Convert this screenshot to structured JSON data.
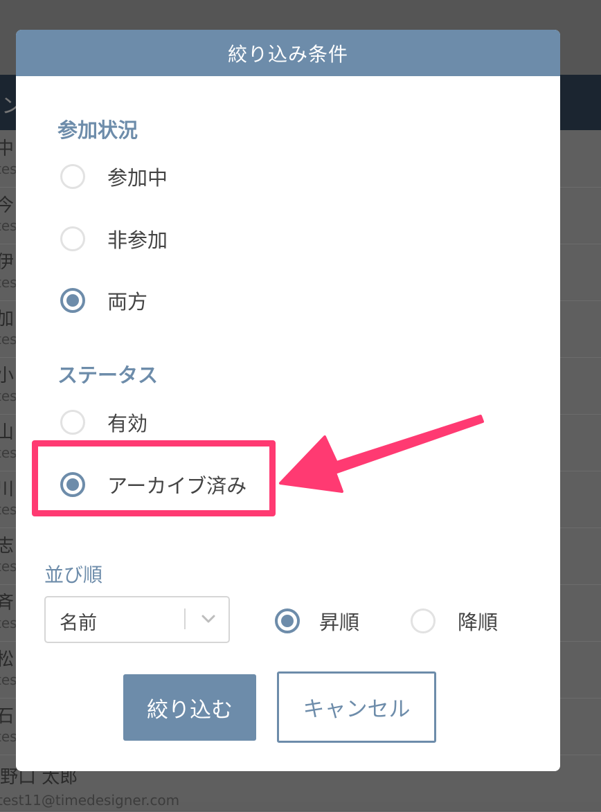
{
  "background": {
    "header_text": "ン",
    "rows": [
      {
        "name": "中",
        "email": "tes"
      },
      {
        "name": "今",
        "email": "tes"
      },
      {
        "name": "伊",
        "email": "tes"
      },
      {
        "name": "加",
        "email": "tes"
      },
      {
        "name": "小",
        "email": "tes"
      },
      {
        "name": "山",
        "email": "tes"
      },
      {
        "name": "川",
        "email": "tes"
      },
      {
        "name": "志",
        "email": "tes"
      },
      {
        "name": "斉",
        "email": "tes"
      },
      {
        "name": "松",
        "email": "tes"
      },
      {
        "name": "石",
        "email": "tes"
      },
      {
        "name": "野口 太郎",
        "email": "test11@timedesigner.com"
      }
    ]
  },
  "modal": {
    "title": "絞り込み条件",
    "participation": {
      "title": "参加状況",
      "options": [
        {
          "label": "参加中",
          "checked": false
        },
        {
          "label": "非参加",
          "checked": false
        },
        {
          "label": "両方",
          "checked": true
        }
      ]
    },
    "status": {
      "title": "ステータス",
      "options": [
        {
          "label": "有効",
          "checked": false
        },
        {
          "label": "アーカイブ済み",
          "checked": true
        }
      ]
    },
    "sort": {
      "title": "並び順",
      "field_value": "名前",
      "order_options": [
        {
          "label": "昇順",
          "checked": true
        },
        {
          "label": "降順",
          "checked": false
        }
      ]
    },
    "apply_label": "絞り込む",
    "cancel_label": "キャンセル"
  },
  "annotation": {
    "highlight_color": "#ff3a72"
  },
  "colors": {
    "accent": "#6d8caa"
  }
}
